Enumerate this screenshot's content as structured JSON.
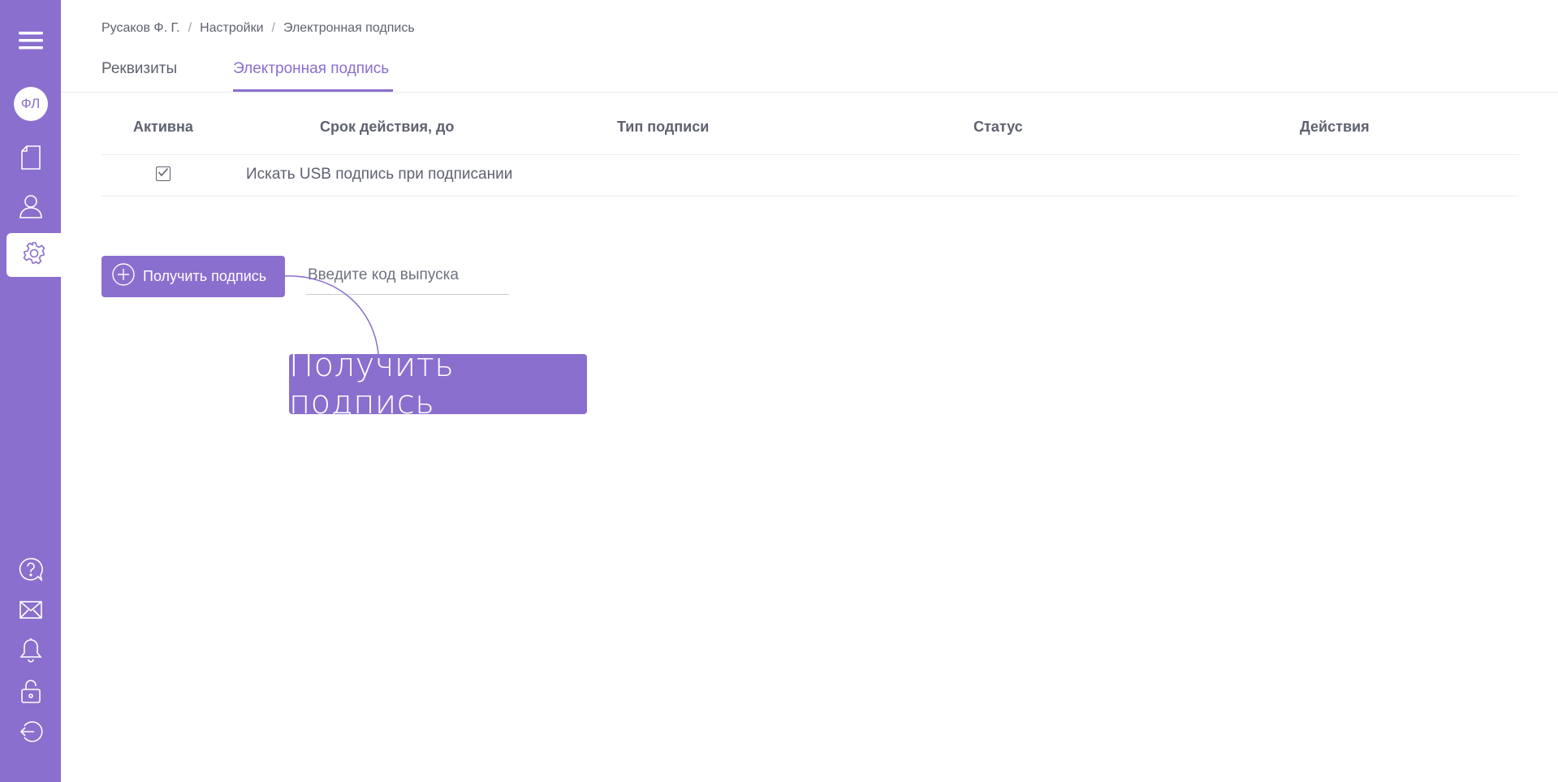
{
  "sidebar": {
    "avatar_initials": "ФЛ",
    "icons": [
      "menu-icon",
      "document-icon",
      "user-icon",
      "gear-icon",
      "help-icon",
      "mail-icon",
      "bell-icon",
      "lock-icon",
      "logout-icon"
    ]
  },
  "breadcrumb": {
    "items": [
      "Русаков Ф. Г.",
      "Настройки",
      "Электронная подпись"
    ],
    "separator": "/"
  },
  "tabs": [
    {
      "label": "Реквизиты",
      "active": false
    },
    {
      "label": "Электронная подпись",
      "active": true
    }
  ],
  "table": {
    "headers": [
      "Активна",
      "Срок действия, до",
      "Тип подписи",
      "Статус",
      "Действия"
    ],
    "rows": [
      {
        "checked": true,
        "text": "Искать USB подпись при подписании"
      }
    ]
  },
  "actions": {
    "get_signature_label": "Получить подпись",
    "code_placeholder": "Введите код выпуска"
  },
  "tooltip": {
    "text": "Получить подпись"
  },
  "colors": {
    "accent": "#8a6fce",
    "text": "#5f6270",
    "divider": "#eceef2"
  }
}
